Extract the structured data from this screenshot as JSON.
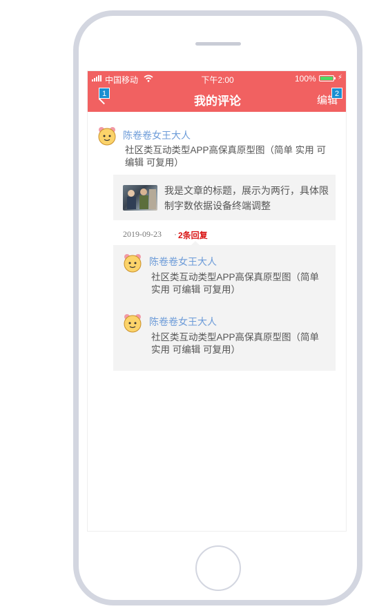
{
  "status_bar": {
    "carrier": "中国移动",
    "time": "下午2:00",
    "battery": "100%"
  },
  "nav": {
    "title": "我的评论",
    "edit_label": "编辑",
    "marker_back": "1",
    "marker_edit": "2"
  },
  "comment": {
    "username": "陈卷卷女王大人",
    "text": "社区类互动类型APP高保真原型图（简单 实用 可编辑 可复用）",
    "article_title": "我是文章的标题，展示为两行，具体限制字数依据设备终端调整",
    "date": "2019-09-23",
    "separator": "·",
    "replies_label": "2条回复"
  },
  "replies": [
    {
      "username": "陈卷卷女王大人",
      "text": "社区类互动类型APP高保真原型图（简单 实用 可编辑 可复用）"
    },
    {
      "username": "陈卷卷女王大人",
      "text": "社区类互动类型APP高保真原型图（简单 实用 可编辑 可复用）"
    }
  ],
  "colors": {
    "header": "#f16161",
    "username": "#6c9bd8",
    "reply_count": "#d91414",
    "card_bg": "#f3f3f3"
  }
}
